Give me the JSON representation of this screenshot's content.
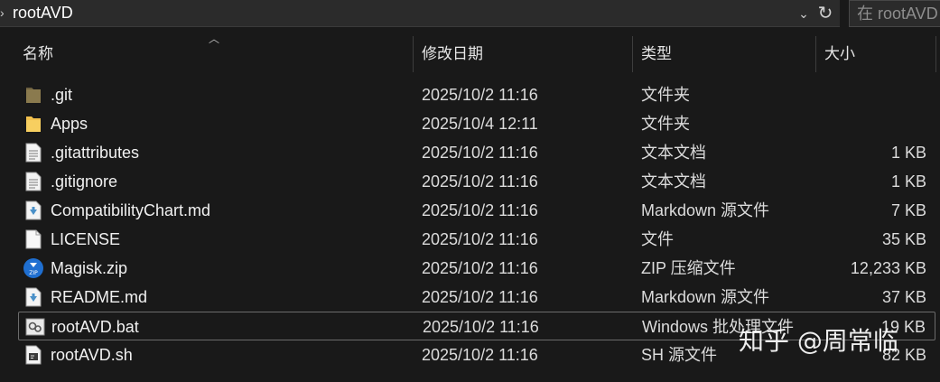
{
  "address_bar": {
    "path": "rootAVD"
  },
  "search": {
    "placeholder": "在 rootAVD 中搜索"
  },
  "columns": {
    "name": "名称",
    "date": "修改日期",
    "type": "类型",
    "size": "大小"
  },
  "files": [
    {
      "name": ".git",
      "date": "2025/10/2 11:16",
      "type": "文件夹",
      "size": "",
      "icon": "folder-dark-icon"
    },
    {
      "name": "Apps",
      "date": "2025/10/4 12:11",
      "type": "文件夹",
      "size": "",
      "icon": "folder-icon"
    },
    {
      "name": ".gitattributes",
      "date": "2025/10/2 11:16",
      "type": "文本文档",
      "size": "1 KB",
      "icon": "text-file-icon"
    },
    {
      "name": ".gitignore",
      "date": "2025/10/2 11:16",
      "type": "文本文档",
      "size": "1 KB",
      "icon": "text-file-icon"
    },
    {
      "name": "CompatibilityChart.md",
      "date": "2025/10/2 11:16",
      "type": "Markdown 源文件",
      "size": "7 KB",
      "icon": "markdown-file-icon"
    },
    {
      "name": "LICENSE",
      "date": "2025/10/2 11:16",
      "type": "文件",
      "size": "35 KB",
      "icon": "blank-file-icon"
    },
    {
      "name": "Magisk.zip",
      "date": "2025/10/2 11:16",
      "type": "ZIP 压缩文件",
      "size": "12,233 KB",
      "icon": "zip-file-icon"
    },
    {
      "name": "README.md",
      "date": "2025/10/2 11:16",
      "type": "Markdown 源文件",
      "size": "37 KB",
      "icon": "markdown-file-icon"
    },
    {
      "name": "rootAVD.bat",
      "date": "2025/10/2 11:16",
      "type": "Windows 批处理文件",
      "size": "19 KB",
      "icon": "batch-file-icon"
    },
    {
      "name": "rootAVD.sh",
      "date": "2025/10/2 11:16",
      "type": "SH 源文件",
      "size": "82 KB",
      "icon": "shell-file-icon"
    }
  ],
  "watermark": "知乎 @周常临",
  "colors": {
    "background": "#191919",
    "folder": "#f2c14e",
    "selection_border": "#6b6b6b",
    "markdown_accent": "#4a90c8",
    "zip_badge": "#1f6fd1"
  }
}
